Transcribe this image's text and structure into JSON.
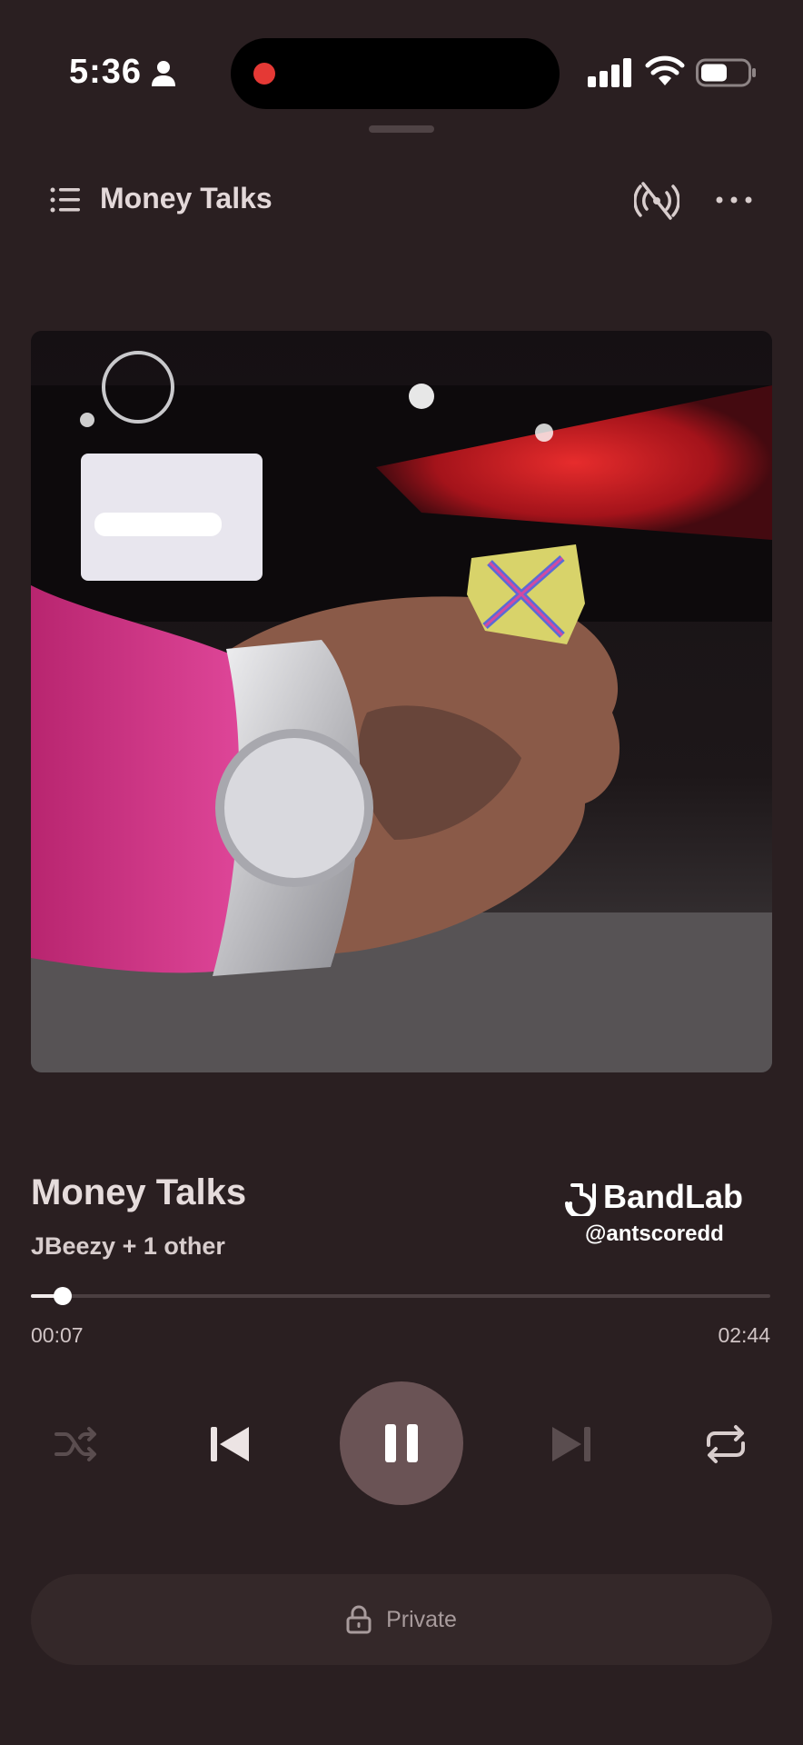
{
  "status_bar": {
    "time": "5:36",
    "battery_level": 0.55
  },
  "header": {
    "title": "Money Talks"
  },
  "track": {
    "title": "Money Talks",
    "artists": "JBeezy + 1 other"
  },
  "watermark": {
    "brand": "BandLab",
    "handle": "@antscoredd"
  },
  "progress": {
    "elapsed": "00:07",
    "total": "02:44",
    "fraction": 0.043
  },
  "footer": {
    "visibility_label": "Private"
  },
  "colors": {
    "background": "#2a1f21",
    "play_button": "#6a5355",
    "recording_dot": "#e53935"
  },
  "icons": [
    "person-icon",
    "signal-icon",
    "wifi-icon",
    "battery-icon",
    "list-icon",
    "cast-off-icon",
    "more-icon",
    "shuffle-icon",
    "previous-icon",
    "pause-icon",
    "next-icon",
    "repeat-icon",
    "lock-icon"
  ]
}
